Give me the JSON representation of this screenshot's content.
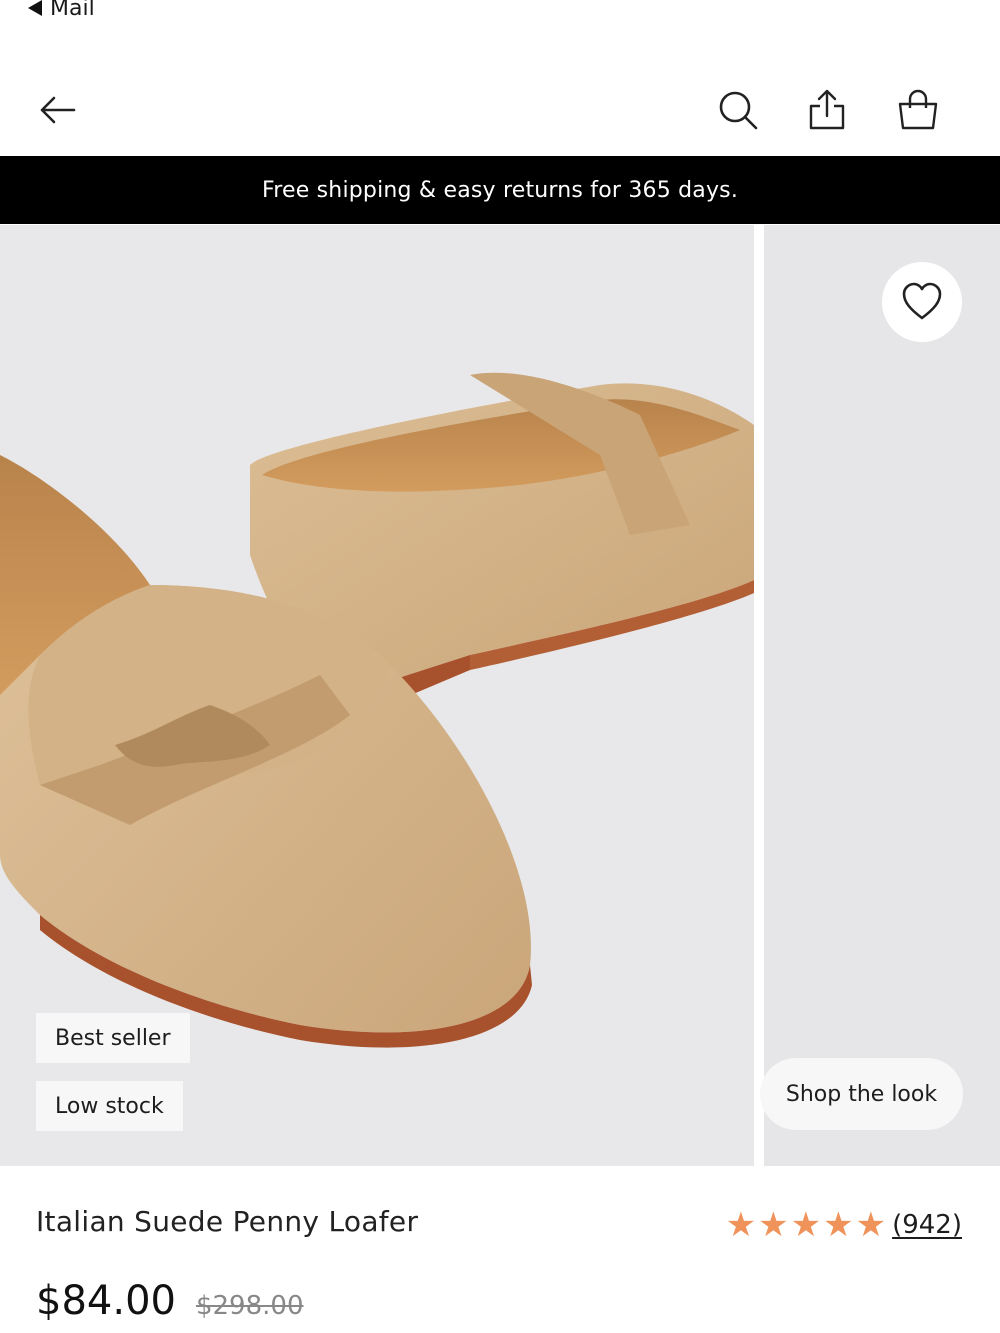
{
  "status": {
    "back_app": "Mail"
  },
  "navbar": {
    "back_icon": "arrow-left-icon",
    "search_icon": "search-icon",
    "share_icon": "share-icon",
    "bag_icon": "shopping-bag-icon"
  },
  "promo": {
    "text": "Free shipping & easy returns for 365 days."
  },
  "gallery": {
    "badges": [
      "Best seller",
      "Low stock"
    ],
    "shop_the_look": "Shop the look",
    "wishlist_icon": "heart-icon"
  },
  "product": {
    "name": "Italian Suede Penny Loafer",
    "rating": 5,
    "review_count": "(942)",
    "price_current": "$84.00",
    "price_original": "$298.00"
  },
  "colors": {
    "promo_bg": "#000000",
    "star": "#f0935a",
    "gallery_bg": "#e8e8ea",
    "suede": "#d4b48a"
  }
}
